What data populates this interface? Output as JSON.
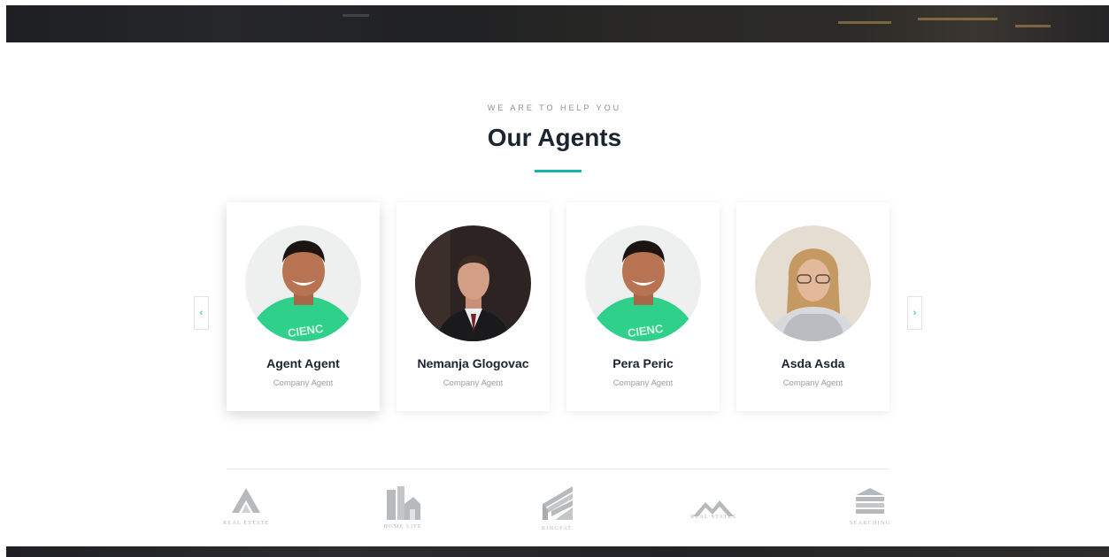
{
  "section": {
    "eyebrow": "WE ARE TO HELP YOU",
    "title": "Our Agents",
    "accent_color": "#18b4a4"
  },
  "carousel": {
    "prev_icon": "chevron-left-icon",
    "next_icon": "chevron-right-icon",
    "prev_glyph": "‹",
    "next_glyph": "›"
  },
  "agents": [
    {
      "name": "Agent Agent",
      "role": "Company Agent",
      "photo": "smiling-man-green-shirt"
    },
    {
      "name": "Nemanja Glogovac",
      "role": "Company Agent",
      "photo": "man-in-suit"
    },
    {
      "name": "Pera Peric",
      "role": "Company Agent",
      "photo": "smiling-man-green-shirt"
    },
    {
      "name": "Asda Asda",
      "role": "Company Agent",
      "photo": "woman-with-glasses"
    }
  ],
  "partners": [
    {
      "label": "REAL ESTATE",
      "icon": "real-estate-logo-icon"
    },
    {
      "label": "HOME LIFE",
      "icon": "home-life-logo-icon"
    },
    {
      "label": "KINGFAT",
      "icon": "kingfat-logo-icon"
    },
    {
      "label": "REAL STATES",
      "icon": "real-states-logo-icon"
    },
    {
      "label": "SEARCHING",
      "icon": "searching-logo-icon"
    }
  ]
}
